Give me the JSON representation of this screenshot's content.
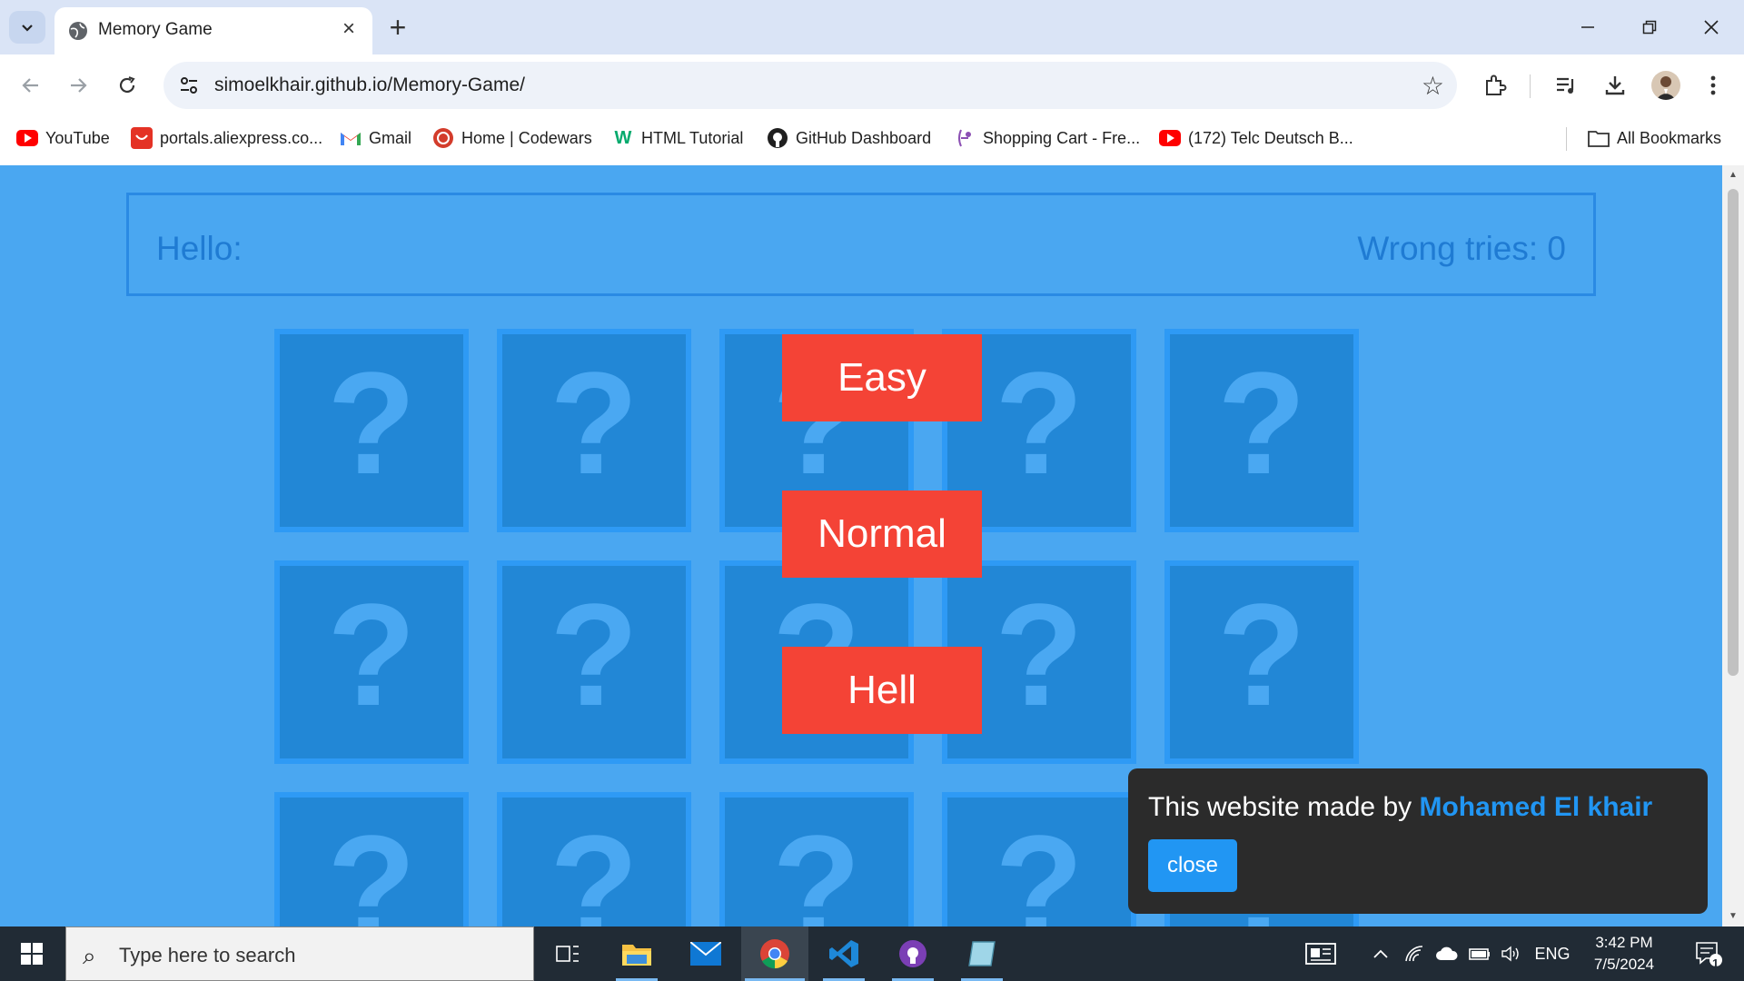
{
  "browser": {
    "tab_title": "Memory Game",
    "url": "simoelkhair.github.io/Memory-Game/",
    "bookmarks": [
      {
        "label": "YouTube",
        "icon": "youtube-icon"
      },
      {
        "label": "portals.aliexpress.co...",
        "icon": "aliexpress-icon"
      },
      {
        "label": "Gmail",
        "icon": "gmail-icon"
      },
      {
        "label": "Home | Codewars",
        "icon": "codewars-icon"
      },
      {
        "label": "HTML Tutorial",
        "icon": "w3schools-icon"
      },
      {
        "label": "GitHub Dashboard",
        "icon": "github-icon"
      },
      {
        "label": "Shopping Cart - Fre...",
        "icon": "shopping-cart-icon"
      },
      {
        "label": "(172) Telc Deutsch B...",
        "icon": "youtube-icon"
      }
    ],
    "all_bookmarks": "All Bookmarks"
  },
  "game": {
    "hello_label": "Hello:",
    "wrong_tries": "Wrong tries: 0",
    "card_symbol": "?",
    "difficulty": {
      "easy": "Easy",
      "normal": "Normal",
      "hell": "Hell"
    }
  },
  "popup": {
    "message": "This website made by",
    "author": "Mohamed El khair",
    "close_label": "close"
  },
  "taskbar": {
    "search_placeholder": "Type here to search",
    "language": "ENG",
    "time": "3:42 PM",
    "date": "7/5/2024",
    "notification_count": "1"
  },
  "colors": {
    "page_bg": "#4aa7f1",
    "card_bg": "#2287d6",
    "button_red": "#f44336",
    "accent_blue": "#2196f3"
  }
}
